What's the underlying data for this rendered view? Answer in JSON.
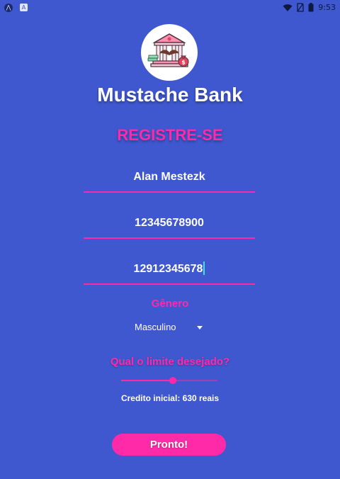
{
  "status_bar": {
    "time": "9:53",
    "icons": [
      "app-notification-icon",
      "keyboard-notification-icon",
      "wifi-icon",
      "no-sim-icon",
      "battery-icon"
    ]
  },
  "header": {
    "app_title": "Mustache Bank",
    "logo": "bank-mustache-logo"
  },
  "form": {
    "heading": "REGISTRE-SE",
    "name_value": "Alan Mestezk",
    "cpf_value": "12345678900",
    "phone_value": "12912345678",
    "gender_label": "Gênero",
    "gender_selected": "Masculino",
    "limit_label": "Qual o limite desejado?",
    "limit_slider_fraction": 0.54,
    "credit_text": "Credito inicial: 630 reais",
    "submit_label": "Pronto!"
  },
  "colors": {
    "background": "#3f57cf",
    "accent": "#ff2aa7",
    "text": "#ffffff"
  }
}
